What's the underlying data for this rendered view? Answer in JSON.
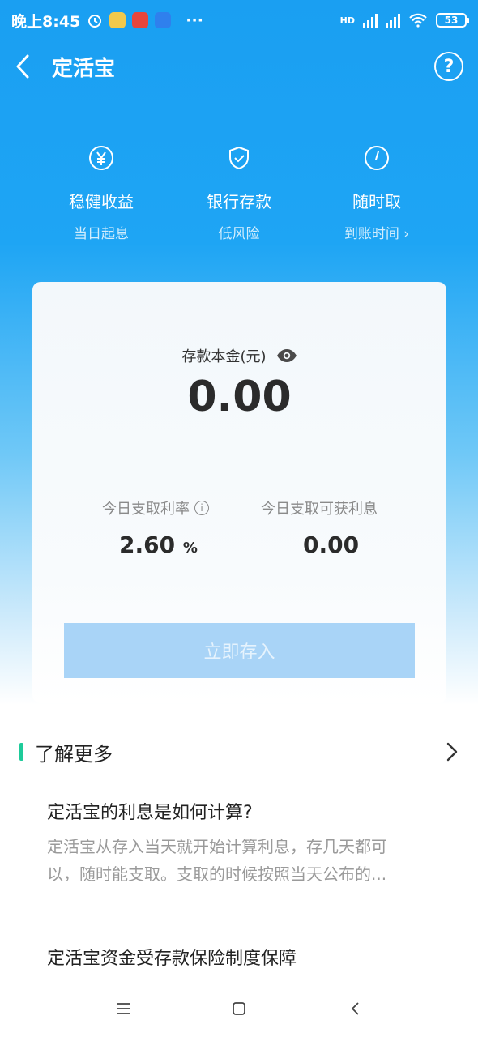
{
  "status_bar": {
    "time": "晚上8:45",
    "more": "···",
    "network": "HD",
    "battery": "53"
  },
  "nav": {
    "title": "定活宝"
  },
  "features": [
    {
      "icon": "yuan-icon",
      "title": "稳健收益",
      "sub": "当日起息"
    },
    {
      "icon": "shield-check-icon",
      "title": "银行存款",
      "sub": "低风险"
    },
    {
      "icon": "clock-icon",
      "title": "随时取",
      "sub": "到账时间 ›"
    }
  ],
  "card": {
    "principal_label": "存款本金(元)",
    "principal_value": "0.00",
    "rate_label": "今日支取利率",
    "rate_value": "2.60",
    "rate_unit": "%",
    "interest_label": "今日支取可获利息",
    "interest_value": "0.00",
    "deposit_button": "立即存入"
  },
  "learn_more": {
    "title": "了解更多",
    "faqs": [
      {
        "question": "定活宝的利息是如何计算?",
        "answer_line1": "定活宝从存入当天就开始计算利息，存几天都可",
        "answer_line2": "以，随时能支取。支取的时候按照当天公布的..."
      },
      {
        "question": "定活宝资金受存款保险制度保障"
      }
    ]
  },
  "colors": {
    "brand_blue": "#1ea5f4",
    "accent_green": "#1ecb9a",
    "button_disabled": "#a9d4f7"
  }
}
